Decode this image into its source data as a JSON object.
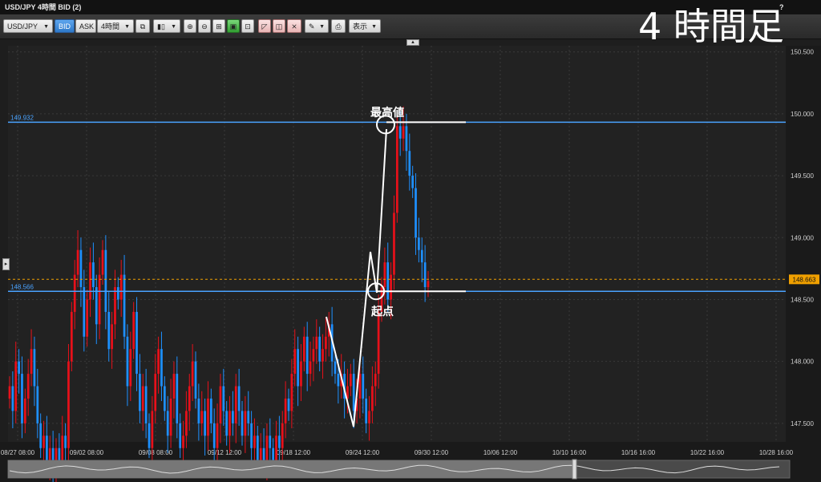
{
  "window": {
    "title": "USD/JPY 4時間 BID (2)",
    "help": "?"
  },
  "overlay_title": "4 時間足",
  "toolbar": {
    "symbol": "USD/JPY",
    "bid_label": "BID",
    "ask_label": "ASK",
    "timeframe": "4時間",
    "display_label": "表示"
  },
  "colors": {
    "up_candle": "#e8101a",
    "down_candle": "#1e90ff",
    "level_line": "#4aa3ff",
    "current_price": "#f0a000",
    "annotation": "#ffffff",
    "grid": "#3a3a3a"
  },
  "annotations": {
    "high_label": "最高値",
    "start_label": "起点"
  },
  "chart_data": {
    "type": "candlestick",
    "symbol": "USD/JPY",
    "timeframe": "4時間",
    "side": "BID",
    "ylim": [
      147.35,
      150.55
    ],
    "y_ticks": [
      "150.500",
      "150.000",
      "149.500",
      "149.000",
      "148.500",
      "148.000",
      "147.500"
    ],
    "x_ticks": [
      "08/27 08:00",
      "09/02 08:00",
      "09/08 08:00",
      "09/12 12:00",
      "09/18 12:00",
      "09/24 12:00",
      "09/30 12:00",
      "10/06 12:00",
      "10/10 16:00",
      "10/16 16:00",
      "10/22 16:00",
      "10/28 16:00"
    ],
    "level_lines": [
      {
        "value": 149.932,
        "label": "149.932"
      },
      {
        "value": 148.566,
        "label": "148.566"
      }
    ],
    "current_price": {
      "value": 148.663,
      "label": "148.663"
    },
    "closes": [
      147.8,
      147.6,
      148.0,
      147.9,
      147.5,
      147.7,
      147.9,
      148.1,
      147.8,
      147.5,
      147.3,
      147.4,
      147.2,
      147.3,
      147.1,
      147.3,
      147.2,
      147.4,
      147.3,
      148.0,
      148.4,
      148.7,
      148.9,
      148.6,
      148.2,
      148.5,
      148.8,
      148.6,
      148.3,
      148.7,
      148.9,
      148.4,
      148.1,
      148.3,
      148.6,
      148.5,
      148.7,
      148.2,
      147.8,
      148.1,
      148.4,
      147.9,
      147.6,
      147.8,
      147.5,
      147.3,
      147.6,
      147.9,
      148.1,
      147.8,
      147.6,
      147.4,
      147.7,
      147.9,
      147.5,
      147.3,
      147.4,
      147.6,
      147.8,
      148.0,
      147.7,
      147.5,
      147.6,
      147.4,
      147.7,
      147.5,
      147.3,
      147.5,
      147.8,
      147.6,
      147.4,
      147.6,
      147.5,
      147.8,
      147.6,
      147.4,
      147.6,
      147.5,
      147.3,
      147.4,
      147.2,
      147.3,
      147.2,
      147.4,
      147.3,
      147.2,
      147.4,
      147.3,
      147.5,
      147.7,
      147.6,
      147.9,
      148.1,
      147.8,
      148.0,
      148.2,
      147.9,
      148.0,
      148.1,
      148.2,
      148.0,
      148.1,
      148.2,
      148.3,
      148.0,
      147.9,
      147.8,
      147.9,
      147.7,
      147.8,
      147.9,
      147.6,
      147.7,
      147.9,
      147.7,
      147.5,
      147.6,
      147.8,
      147.9,
      148.4,
      148.6,
      148.8,
      148.5,
      148.7,
      149.2,
      149.9,
      149.8,
      149.9,
      149.7,
      149.5,
      149.4,
      149.0,
      148.9,
      148.8,
      148.6,
      148.65
    ],
    "x_range_bars": 300
  },
  "scroller": {
    "label": "navigator"
  }
}
